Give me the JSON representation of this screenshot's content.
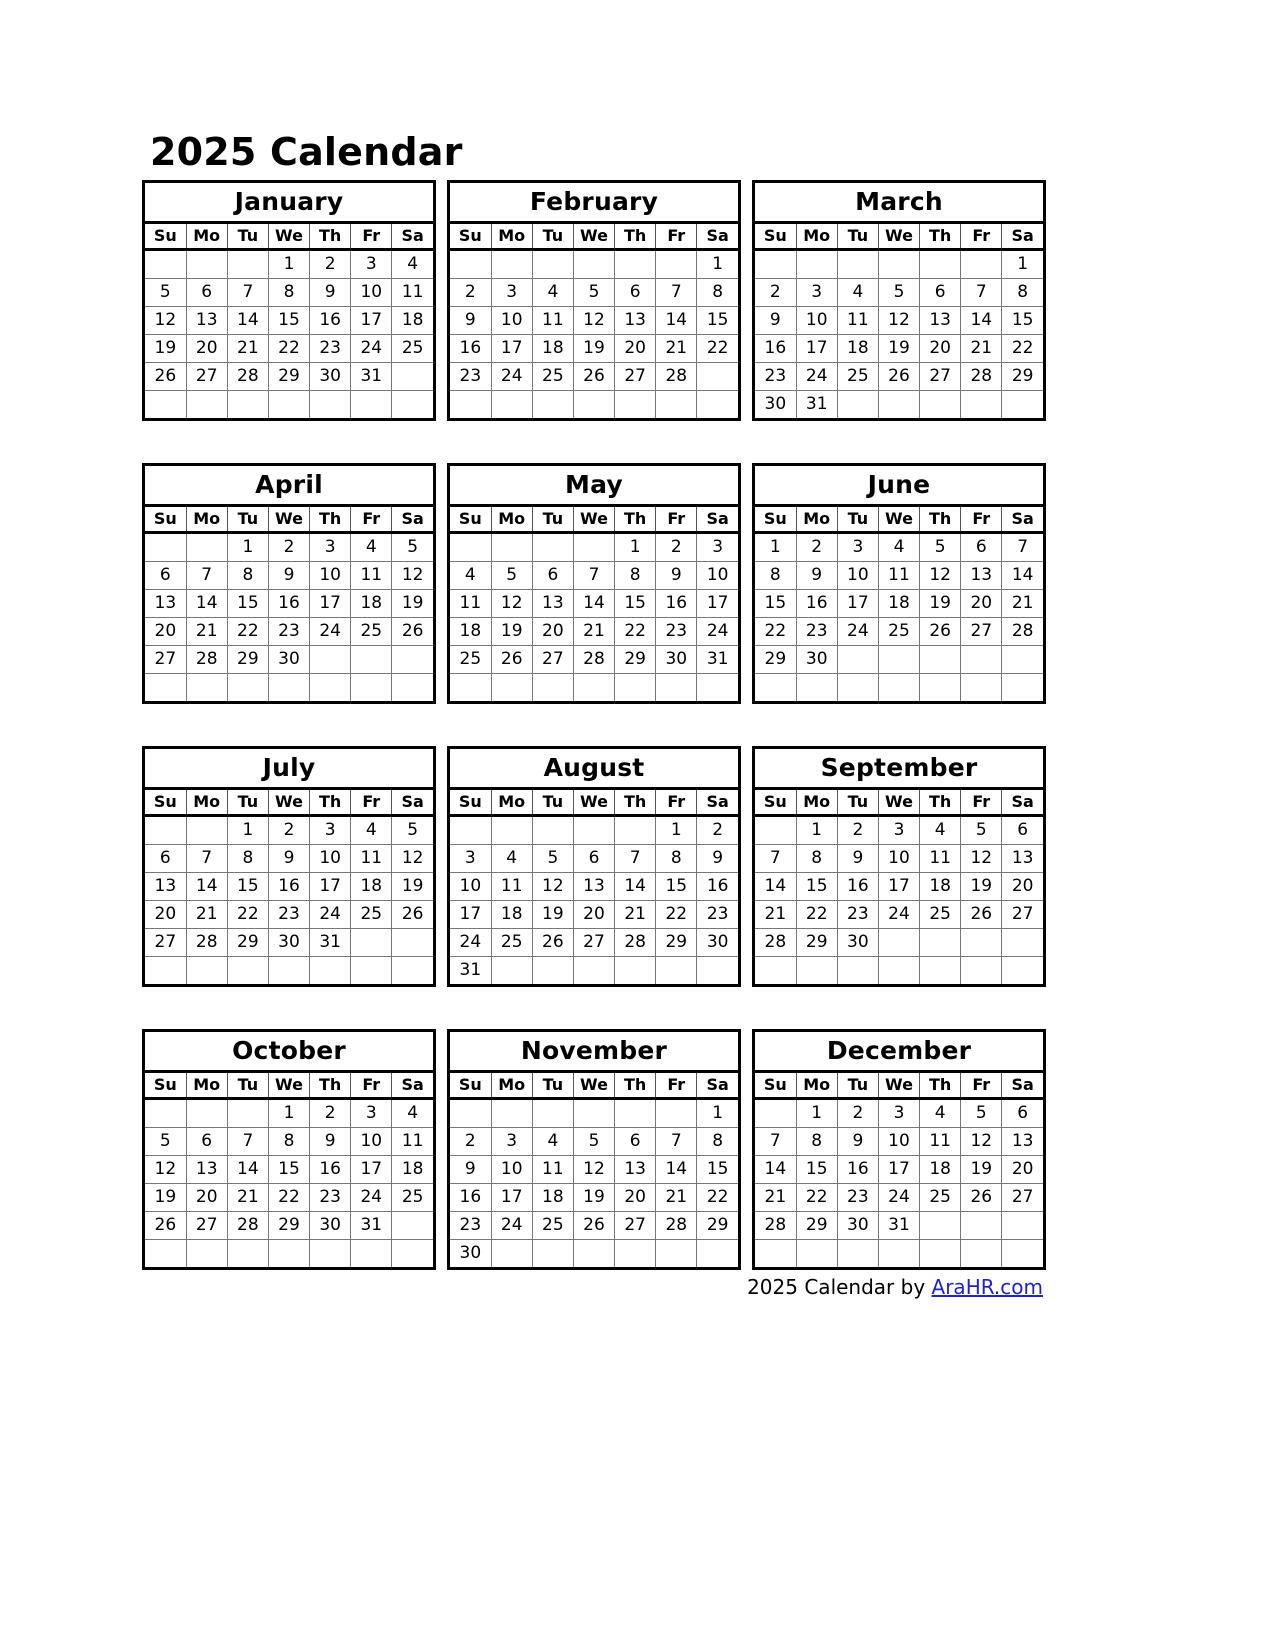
{
  "title": "2025 Calendar",
  "year": "2025",
  "weekday_headers": [
    "Su",
    "Mo",
    "Tu",
    "We",
    "Th",
    "Fr",
    "Sa"
  ],
  "footer": {
    "year": "2025",
    "text": " Calendar by ",
    "link_label": "AraHR.com",
    "link_color": "#2222cc"
  },
  "colors": {
    "border": "#000000",
    "cell_line": "#777777",
    "background": "#ffffff",
    "text": "#000000"
  },
  "months": [
    {
      "name": "January",
      "weeks": [
        [
          "",
          "",
          "",
          "1",
          "2",
          "3",
          "4"
        ],
        [
          "5",
          "6",
          "7",
          "8",
          "9",
          "10",
          "11"
        ],
        [
          "12",
          "13",
          "14",
          "15",
          "16",
          "17",
          "18"
        ],
        [
          "19",
          "20",
          "21",
          "22",
          "23",
          "24",
          "25"
        ],
        [
          "26",
          "27",
          "28",
          "29",
          "30",
          "31",
          ""
        ],
        [
          "",
          "",
          "",
          "",
          "",
          "",
          ""
        ]
      ]
    },
    {
      "name": "February",
      "weeks": [
        [
          "",
          "",
          "",
          "",
          "",
          "",
          "1"
        ],
        [
          "2",
          "3",
          "4",
          "5",
          "6",
          "7",
          "8"
        ],
        [
          "9",
          "10",
          "11",
          "12",
          "13",
          "14",
          "15"
        ],
        [
          "16",
          "17",
          "18",
          "19",
          "20",
          "21",
          "22"
        ],
        [
          "23",
          "24",
          "25",
          "26",
          "27",
          "28",
          ""
        ],
        [
          "",
          "",
          "",
          "",
          "",
          "",
          ""
        ]
      ]
    },
    {
      "name": "March",
      "weeks": [
        [
          "",
          "",
          "",
          "",
          "",
          "",
          "1"
        ],
        [
          "2",
          "3",
          "4",
          "5",
          "6",
          "7",
          "8"
        ],
        [
          "9",
          "10",
          "11",
          "12",
          "13",
          "14",
          "15"
        ],
        [
          "16",
          "17",
          "18",
          "19",
          "20",
          "21",
          "22"
        ],
        [
          "23",
          "24",
          "25",
          "26",
          "27",
          "28",
          "29"
        ],
        [
          "30",
          "31",
          "",
          "",
          "",
          "",
          ""
        ]
      ]
    },
    {
      "name": "April",
      "weeks": [
        [
          "",
          "",
          "1",
          "2",
          "3",
          "4",
          "5"
        ],
        [
          "6",
          "7",
          "8",
          "9",
          "10",
          "11",
          "12"
        ],
        [
          "13",
          "14",
          "15",
          "16",
          "17",
          "18",
          "19"
        ],
        [
          "20",
          "21",
          "22",
          "23",
          "24",
          "25",
          "26"
        ],
        [
          "27",
          "28",
          "29",
          "30",
          "",
          "",
          ""
        ],
        [
          "",
          "",
          "",
          "",
          "",
          "",
          ""
        ]
      ]
    },
    {
      "name": "May",
      "weeks": [
        [
          "",
          "",
          "",
          "",
          "1",
          "2",
          "3"
        ],
        [
          "4",
          "5",
          "6",
          "7",
          "8",
          "9",
          "10"
        ],
        [
          "11",
          "12",
          "13",
          "14",
          "15",
          "16",
          "17"
        ],
        [
          "18",
          "19",
          "20",
          "21",
          "22",
          "23",
          "24"
        ],
        [
          "25",
          "26",
          "27",
          "28",
          "29",
          "30",
          "31"
        ],
        [
          "",
          "",
          "",
          "",
          "",
          "",
          ""
        ]
      ]
    },
    {
      "name": "June",
      "weeks": [
        [
          "1",
          "2",
          "3",
          "4",
          "5",
          "6",
          "7"
        ],
        [
          "8",
          "9",
          "10",
          "11",
          "12",
          "13",
          "14"
        ],
        [
          "15",
          "16",
          "17",
          "18",
          "19",
          "20",
          "21"
        ],
        [
          "22",
          "23",
          "24",
          "25",
          "26",
          "27",
          "28"
        ],
        [
          "29",
          "30",
          "",
          "",
          "",
          "",
          ""
        ],
        [
          "",
          "",
          "",
          "",
          "",
          "",
          ""
        ]
      ]
    },
    {
      "name": "July",
      "weeks": [
        [
          "",
          "",
          "1",
          "2",
          "3",
          "4",
          "5"
        ],
        [
          "6",
          "7",
          "8",
          "9",
          "10",
          "11",
          "12"
        ],
        [
          "13",
          "14",
          "15",
          "16",
          "17",
          "18",
          "19"
        ],
        [
          "20",
          "21",
          "22",
          "23",
          "24",
          "25",
          "26"
        ],
        [
          "27",
          "28",
          "29",
          "30",
          "31",
          "",
          ""
        ],
        [
          "",
          "",
          "",
          "",
          "",
          "",
          ""
        ]
      ]
    },
    {
      "name": "August",
      "weeks": [
        [
          "",
          "",
          "",
          "",
          "",
          "1",
          "2"
        ],
        [
          "3",
          "4",
          "5",
          "6",
          "7",
          "8",
          "9"
        ],
        [
          "10",
          "11",
          "12",
          "13",
          "14",
          "15",
          "16"
        ],
        [
          "17",
          "18",
          "19",
          "20",
          "21",
          "22",
          "23"
        ],
        [
          "24",
          "25",
          "26",
          "27",
          "28",
          "29",
          "30"
        ],
        [
          "31",
          "",
          "",
          "",
          "",
          "",
          ""
        ]
      ]
    },
    {
      "name": "September",
      "weeks": [
        [
          "",
          "1",
          "2",
          "3",
          "4",
          "5",
          "6"
        ],
        [
          "7",
          "8",
          "9",
          "10",
          "11",
          "12",
          "13"
        ],
        [
          "14",
          "15",
          "16",
          "17",
          "18",
          "19",
          "20"
        ],
        [
          "21",
          "22",
          "23",
          "24",
          "25",
          "26",
          "27"
        ],
        [
          "28",
          "29",
          "30",
          "",
          "",
          "",
          ""
        ],
        [
          "",
          "",
          "",
          "",
          "",
          "",
          ""
        ]
      ]
    },
    {
      "name": "October",
      "weeks": [
        [
          "",
          "",
          "",
          "1",
          "2",
          "3",
          "4"
        ],
        [
          "5",
          "6",
          "7",
          "8",
          "9",
          "10",
          "11"
        ],
        [
          "12",
          "13",
          "14",
          "15",
          "16",
          "17",
          "18"
        ],
        [
          "19",
          "20",
          "21",
          "22",
          "23",
          "24",
          "25"
        ],
        [
          "26",
          "27",
          "28",
          "29",
          "30",
          "31",
          ""
        ],
        [
          "",
          "",
          "",
          "",
          "",
          "",
          ""
        ]
      ]
    },
    {
      "name": "November",
      "weeks": [
        [
          "",
          "",
          "",
          "",
          "",
          "",
          "1"
        ],
        [
          "2",
          "3",
          "4",
          "5",
          "6",
          "7",
          "8"
        ],
        [
          "9",
          "10",
          "11",
          "12",
          "13",
          "14",
          "15"
        ],
        [
          "16",
          "17",
          "18",
          "19",
          "20",
          "21",
          "22"
        ],
        [
          "23",
          "24",
          "25",
          "26",
          "27",
          "28",
          "29"
        ],
        [
          "30",
          "",
          "",
          "",
          "",
          "",
          ""
        ]
      ]
    },
    {
      "name": "December",
      "weeks": [
        [
          "",
          "1",
          "2",
          "3",
          "4",
          "5",
          "6"
        ],
        [
          "7",
          "8",
          "9",
          "10",
          "11",
          "12",
          "13"
        ],
        [
          "14",
          "15",
          "16",
          "17",
          "18",
          "19",
          "20"
        ],
        [
          "21",
          "22",
          "23",
          "24",
          "25",
          "26",
          "27"
        ],
        [
          "28",
          "29",
          "30",
          "31",
          "",
          "",
          ""
        ],
        [
          "",
          "",
          "",
          "",
          "",
          "",
          ""
        ]
      ]
    }
  ]
}
